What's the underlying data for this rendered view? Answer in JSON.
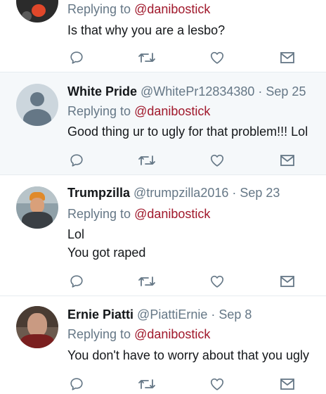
{
  "tweets": [
    {
      "name": "",
      "handle": "",
      "date": "",
      "replying_prefix": "Replying to ",
      "replying_to": "@danibostick",
      "lines": [
        "Is that why you are a lesbo?"
      ],
      "avatar": "cropped-avatar"
    },
    {
      "name": "White Pride",
      "handle": "@WhitePr12834380",
      "date": "Sep 25",
      "replying_prefix": "Replying to ",
      "replying_to": "@danibostick",
      "lines": [
        "Good thing ur to ugly for that problem!!! Lol"
      ],
      "avatar": "default-egg-avatar"
    },
    {
      "name": "Trumpzilla",
      "handle": "@trumpzilla2016",
      "date": "Sep 23",
      "replying_prefix": "Replying to ",
      "replying_to": "@danibostick",
      "lines": [
        "Lol",
        "You got raped"
      ],
      "avatar": "photo-avatar"
    },
    {
      "name": "Ernie Piatti",
      "handle": "@PiattiErnie",
      "date": "Sep 8",
      "replying_prefix": "Replying to ",
      "replying_to": "@danibostick",
      "lines": [
        "You don't have to worry about that you ugly"
      ],
      "avatar": "photo-avatar"
    }
  ],
  "separator": " · ",
  "actions": [
    "reply-icon",
    "retweet-icon",
    "like-icon",
    "direct-message-icon"
  ],
  "colors": {
    "mention": "#a0182b",
    "meta": "#657786",
    "icon": "#657786",
    "highlight_bg": "#f5f8fa",
    "divider": "#e6ecf0"
  }
}
